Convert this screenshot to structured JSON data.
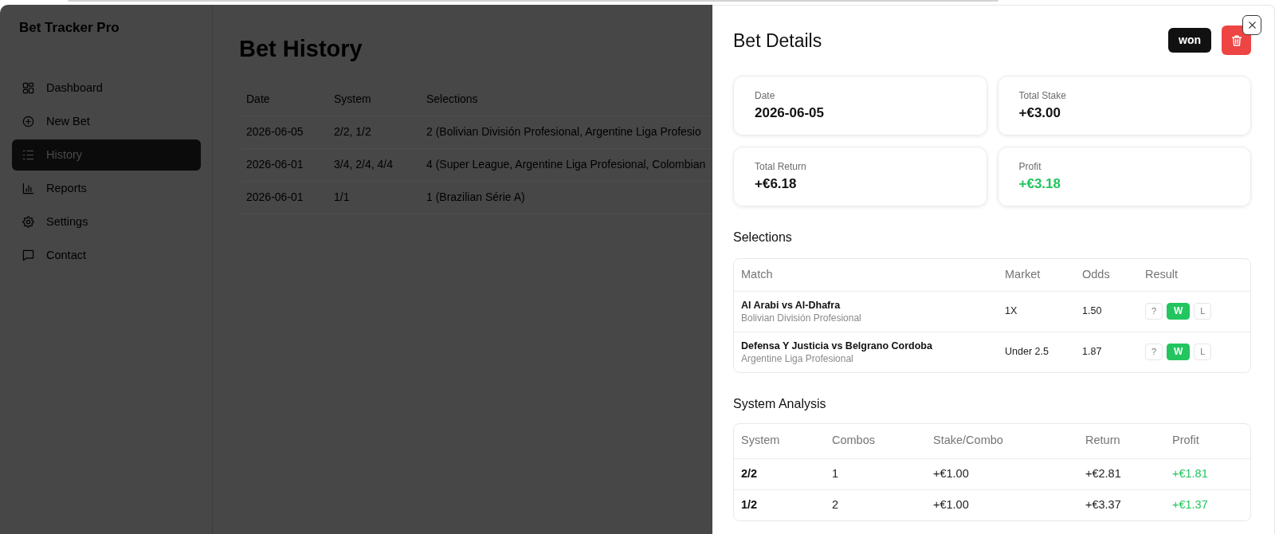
{
  "sidebar": {
    "brand": "Bet Tracker Pro",
    "items": [
      {
        "label": "Dashboard",
        "selected": false
      },
      {
        "label": "New Bet",
        "selected": false
      },
      {
        "label": "History",
        "selected": true
      },
      {
        "label": "Reports",
        "selected": false
      },
      {
        "label": "Settings",
        "selected": false
      },
      {
        "label": "Contact",
        "selected": false
      }
    ]
  },
  "page": {
    "title": "Bet History",
    "table": {
      "columns": [
        "Date",
        "System",
        "Selections"
      ],
      "rows": [
        [
          "2026-06-05",
          "2/2, 1/2",
          "2 (Bolivian División Profesional, Argentine Liga Profesio"
        ],
        [
          "2026-06-01",
          "3/4, 2/4, 4/4",
          "4 (Super League, Argentine Liga Profesional, Colombian"
        ],
        [
          "2026-06-01",
          "1/1",
          "1 (Brazilian Série A)"
        ]
      ]
    }
  },
  "details": {
    "title": "Bet Details",
    "status": "won",
    "stats": [
      {
        "label": "Date",
        "value": "2026-06-05",
        "positive": false
      },
      {
        "label": "Total Stake",
        "value": "+€3.00",
        "positive": false
      },
      {
        "label": "Total Return",
        "value": "+€6.18",
        "positive": false
      },
      {
        "label": "Profit",
        "value": "+€3.18",
        "positive": true
      }
    ],
    "selections": {
      "title": "Selections",
      "columns": [
        "Match",
        "Market",
        "Odds",
        "Result"
      ],
      "rows": [
        {
          "match": "Al Arabi vs Al-Dhafra",
          "league": "Bolivian División Profesional",
          "market": "1X",
          "odds": "1.50",
          "results": [
            {
              "label": "?",
              "selected": false
            },
            {
              "label": "W",
              "selected": true
            },
            {
              "label": "L",
              "selected": false
            }
          ]
        },
        {
          "match": "Defensa Y Justicia vs Belgrano Cordoba",
          "league": "Argentine Liga Profesional",
          "market": "Under 2.5",
          "odds": "1.87",
          "results": [
            {
              "label": "?",
              "selected": false
            },
            {
              "label": "W",
              "selected": true
            },
            {
              "label": "L",
              "selected": false
            }
          ]
        }
      ]
    },
    "system_analysis": {
      "title": "System Analysis",
      "columns": [
        "System",
        "Combos",
        "Stake/Combo",
        "Return",
        "Profit"
      ],
      "rows": [
        {
          "cells": [
            "2/2",
            "1",
            "+€1.00",
            "+€2.81",
            "+€1.81"
          ],
          "positive": true
        },
        {
          "cells": [
            "1/2",
            "2",
            "+€1.00",
            "+€3.37",
            "+€1.37"
          ],
          "positive": true
        }
      ]
    }
  }
}
